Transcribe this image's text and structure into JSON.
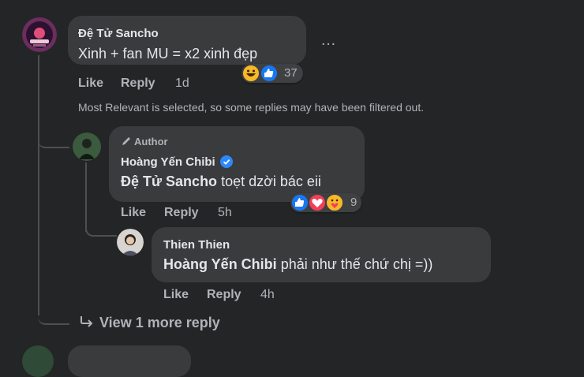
{
  "comment": {
    "author": "Đệ Tử Sancho",
    "text": "Xinh + fan MU = x2 xinh đẹp",
    "reaction_count": "37",
    "actions": {
      "like": "Like",
      "reply": "Reply",
      "time": "1d"
    },
    "more_icon": "…"
  },
  "filter_note": "Most Relevant is selected, so some replies may have been filtered out.",
  "reply1": {
    "badge": "Author",
    "author": "Hoàng Yến Chibi",
    "mention": "Đệ Tử Sancho",
    "text": " toẹt dzời bác eii",
    "reaction_count": "9",
    "actions": {
      "like": "Like",
      "reply": "Reply",
      "time": "5h"
    }
  },
  "reply2": {
    "author": "Thien Thien",
    "mention": "Hoàng Yến Chibi",
    "text": " phải như thế chứ chị =))",
    "actions": {
      "like": "Like",
      "reply": "Reply",
      "time": "4h"
    }
  },
  "view_more": "View 1 more reply",
  "colors": {
    "background": "#242526",
    "bubble": "#3a3b3c",
    "like_blue": "#1877f2",
    "love_red": "#f33e58",
    "verified_blue": "#2d88ff"
  }
}
